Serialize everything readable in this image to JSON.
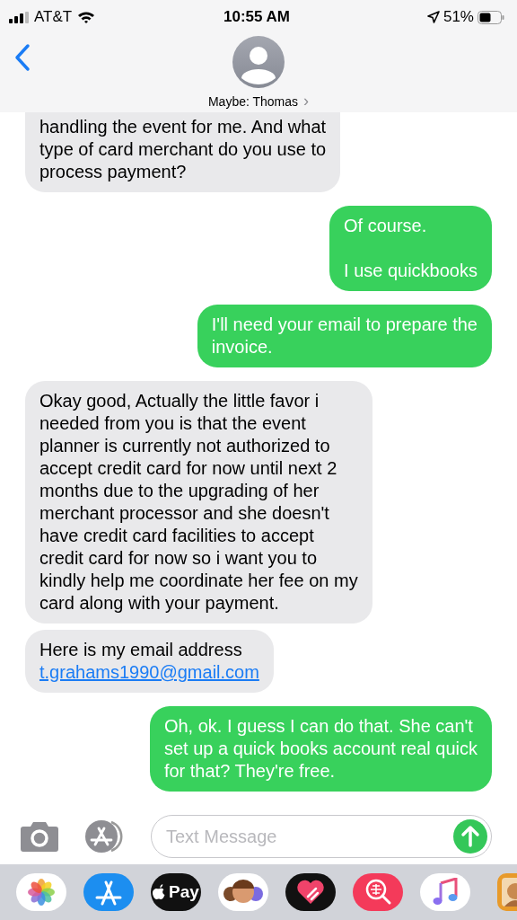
{
  "status_bar": {
    "carrier": "AT&T",
    "time": "10:55 AM",
    "battery": "51%"
  },
  "header": {
    "contact": "Maybe: Thomas",
    "chevron": "›"
  },
  "messages": [
    {
      "kind": "received",
      "text": "handling the event for me. And what\ntype of card merchant do you use to\nprocess payment?",
      "cut_top": true
    },
    {
      "kind": "sent",
      "text": "Of course.\n\nI use quickbooks"
    },
    {
      "kind": "sent",
      "text": "I'll need your email to prepare the\ninvoice."
    },
    {
      "kind": "received",
      "text": "Okay good, Actually the little favor i\nneeded from you is that the event\nplanner is currently not authorized to\naccept credit card for now until next 2\nmonths due to the upgrading of her\nmerchant processor and she doesn't\nhave credit card facilities to accept\ncredit card for now so i want you to\nkindly help me coordinate her fee on my\ncard along with your payment."
    },
    {
      "kind": "received",
      "text": "Here is my email address",
      "link": "t.grahams1990@gmail.com"
    },
    {
      "kind": "sent",
      "text": "Oh, ok. I guess I can do that. She can't\nset up a quick books account real quick\nfor that? They're free."
    }
  ],
  "composer": {
    "placeholder": "Text Message"
  },
  "app_drawer": [
    {
      "kind": "photos"
    },
    {
      "kind": "appstore"
    },
    {
      "kind": "pay",
      "label": "Pay"
    },
    {
      "kind": "memoji"
    },
    {
      "kind": "heart"
    },
    {
      "kind": "search"
    },
    {
      "kind": "music"
    },
    {
      "kind": "picture"
    }
  ]
}
